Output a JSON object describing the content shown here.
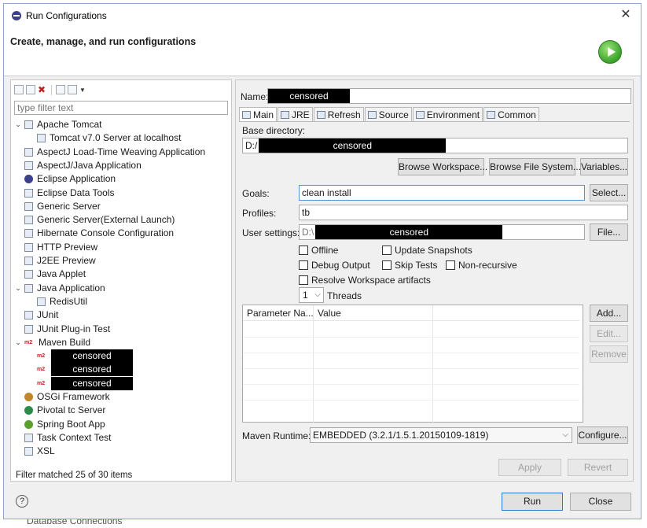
{
  "window": {
    "title": "Run Configurations",
    "subtitle": "Create, manage, and run configurations"
  },
  "left": {
    "filter_placeholder": "type filter text",
    "status": "Filter matched 25 of 30 items",
    "tree": [
      {
        "label": "Apache Tomcat",
        "level": 0,
        "expandable": true,
        "icon": "server-icon"
      },
      {
        "label": "Tomcat v7.0 Server at localhost",
        "level": 1,
        "icon": "server-icon"
      },
      {
        "label": "AspectJ Load-Time Weaving Application",
        "level": 0,
        "icon": "aspectj-icon"
      },
      {
        "label": "AspectJ/Java Application",
        "level": 0,
        "icon": "aspectj-java-icon"
      },
      {
        "label": "Eclipse Application",
        "level": 0,
        "icon": "eclipse-icon"
      },
      {
        "label": "Eclipse Data Tools",
        "level": 0,
        "icon": "data-tools-icon"
      },
      {
        "label": "Generic Server",
        "level": 0,
        "icon": "server-icon"
      },
      {
        "label": "Generic Server(External Launch)",
        "level": 0,
        "icon": "server-icon"
      },
      {
        "label": "Hibernate Console Configuration",
        "level": 0,
        "icon": "hibernate-icon"
      },
      {
        "label": "HTTP Preview",
        "level": 0,
        "icon": "server-icon"
      },
      {
        "label": "J2EE Preview",
        "level": 0,
        "icon": "server-icon"
      },
      {
        "label": "Java Applet",
        "level": 0,
        "icon": "applet-icon"
      },
      {
        "label": "Java Application",
        "level": 0,
        "expandable": true,
        "icon": "java-app-icon"
      },
      {
        "label": "RedisUtil",
        "level": 1,
        "icon": "java-app-icon"
      },
      {
        "label": "JUnit",
        "level": 0,
        "icon": "junit-icon"
      },
      {
        "label": "JUnit Plug-in Test",
        "level": 0,
        "icon": "junit-plugin-icon"
      },
      {
        "label": "Maven Build",
        "level": 0,
        "expandable": true,
        "icon": "maven-icon"
      },
      {
        "label": "censored",
        "level": 1,
        "icon": "maven-icon",
        "censored": true
      },
      {
        "label": "censored",
        "level": 1,
        "icon": "maven-icon",
        "censored": true
      },
      {
        "label": "censored",
        "level": 1,
        "icon": "maven-icon",
        "censored": true
      },
      {
        "label": "OSGi Framework",
        "level": 0,
        "icon": "osgi-icon"
      },
      {
        "label": "Pivotal tc Server",
        "level": 0,
        "icon": "pivotal-icon"
      },
      {
        "label": "Spring Boot App",
        "level": 0,
        "icon": "spring-icon"
      },
      {
        "label": "Task Context Test",
        "level": 0,
        "icon": "junit-icon"
      },
      {
        "label": "XSL",
        "level": 0,
        "icon": "xsl-icon"
      }
    ]
  },
  "right": {
    "name_label": "Name:",
    "name_value": "censored",
    "tabs": [
      "Main",
      "JRE",
      "Refresh",
      "Source",
      "Environment",
      "Common"
    ],
    "base_dir_label": "Base directory:",
    "base_dir_prefix": "D:/",
    "base_dir_value": "censored",
    "browse_workspace": "Browse Workspace...",
    "browse_fs": "Browse File System...",
    "variables": "Variables...",
    "goals_label": "Goals:",
    "goals_value": "clean install",
    "select_btn": "Select...",
    "profiles_label": "Profiles:",
    "profiles_value": "tb",
    "user_settings_label": "User settings:",
    "user_settings_prefix": "D:\\",
    "user_settings_value": "censored",
    "file_btn": "File...",
    "offline": "Offline",
    "update_snapshots": "Update Snapshots",
    "debug_output": "Debug Output",
    "skip_tests": "Skip Tests",
    "non_recursive": "Non-recursive",
    "resolve_workspace": "Resolve Workspace artifacts",
    "threads_value": "1",
    "threads_label": "Threads",
    "param_col1": "Parameter Na...",
    "param_col2": "Value",
    "add_btn": "Add...",
    "edit_btn": "Edit...",
    "remove_btn": "Remove",
    "maven_runtime_label": "Maven Runtime:",
    "maven_runtime_value": "EMBEDDED (3.2.1/1.5.1.20150109-1819)",
    "configure_btn": "Configure...",
    "apply_btn": "Apply",
    "revert_btn": "Revert"
  },
  "footer": {
    "run_btn": "Run",
    "close_btn": "Close"
  },
  "background_text": "Database Connections"
}
